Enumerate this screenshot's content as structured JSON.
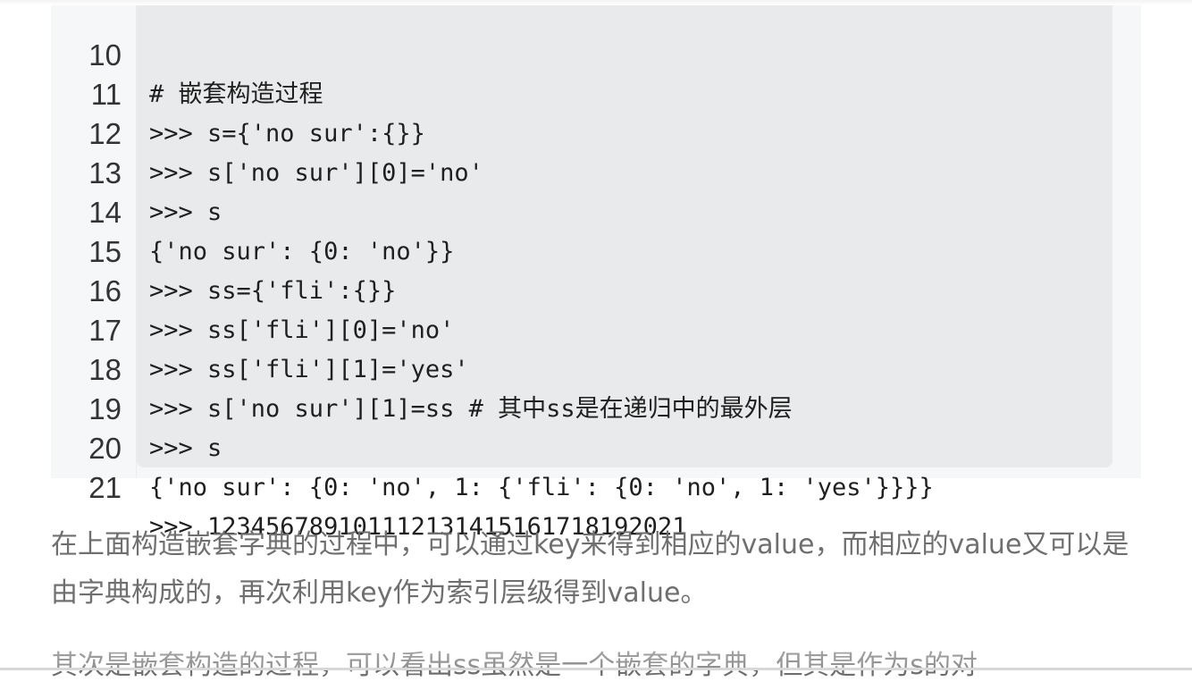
{
  "code_block": {
    "lines": [
      {
        "no": "10",
        "code": "# 嵌套构造过程"
      },
      {
        "no": "11",
        "code": ">>> s={'no sur':{}}"
      },
      {
        "no": "12",
        "code": ">>> s['no sur'][0]='no'"
      },
      {
        "no": "13",
        "code": ">>> s"
      },
      {
        "no": "14",
        "code": "{'no sur': {0: 'no'}}"
      },
      {
        "no": "15",
        "code": ">>> ss={'fli':{}}"
      },
      {
        "no": "16",
        "code": ">>> ss['fli'][0]='no'"
      },
      {
        "no": "17",
        "code": ">>> ss['fli'][1]='yes'"
      },
      {
        "no": "18",
        "code": ">>> s['no sur'][1]=ss # 其中ss是在递归中的最外层"
      },
      {
        "no": "19",
        "code": ">>> s"
      },
      {
        "no": "20",
        "code": "{'no sur': {0: 'no', 1: {'fli': {0: 'no', 1: 'yes'}}}}"
      },
      {
        "no": "21",
        "code": ">>> 123456789101112131415161718192021"
      }
    ]
  },
  "article": {
    "paragraph_1": "在上面构造嵌套字典的过程中，可以通过key来得到相应的value，而相应的value又可以是由字典构成的，再次利用key作为索引层级得到value。",
    "paragraph_2": "其次是嵌套构造的过程，可以看出ss虽然是一个嵌套的字典，但其是作为s的对"
  }
}
